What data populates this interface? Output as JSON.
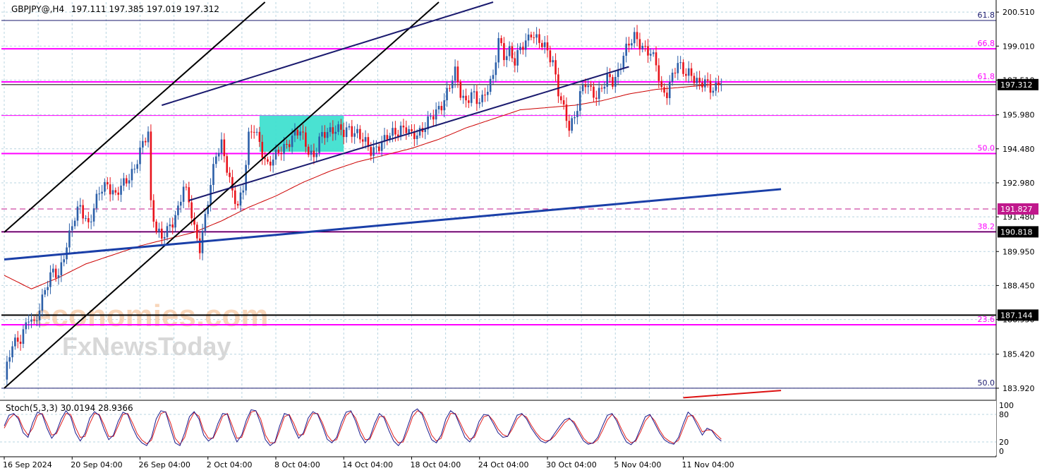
{
  "header": {
    "symbol": "GBPJPY@,H4",
    "ohlc": "197.111 197.385 197.019 197.312"
  },
  "stoch": {
    "label": "Stoch(5,3,3) 30.0194 28.9366",
    "levels": [
      "100",
      "80",
      "20",
      "0"
    ],
    "main": [
      55,
      78,
      82,
      70,
      40,
      30,
      62,
      85,
      80,
      50,
      28,
      42,
      70,
      88,
      75,
      40,
      22,
      38,
      72,
      86,
      78,
      48,
      25,
      35,
      65,
      85,
      80,
      52,
      30,
      18,
      12,
      30,
      70,
      88,
      85,
      50,
      18,
      12,
      40,
      75,
      86,
      70,
      35,
      22,
      30,
      60,
      82,
      80,
      45,
      20,
      35,
      68,
      90,
      88,
      60,
      25,
      12,
      20,
      55,
      82,
      78,
      50,
      28,
      40,
      72,
      86,
      80,
      55,
      26,
      18,
      30,
      62,
      85,
      88,
      65,
      35,
      18,
      30,
      60,
      82,
      72,
      45,
      22,
      12,
      25,
      55,
      85,
      92,
      80,
      50,
      25,
      18,
      35,
      70,
      88,
      80,
      55,
      30,
      20,
      35,
      65,
      80,
      78,
      60,
      40,
      30,
      32,
      55,
      78,
      82,
      70,
      50,
      35,
      22,
      18,
      25,
      40,
      55,
      68,
      72,
      60,
      40,
      22,
      15,
      18,
      30,
      55,
      78,
      82,
      65,
      40,
      20,
      14,
      25,
      50,
      75,
      80,
      60,
      40,
      25,
      18,
      15,
      30,
      60,
      85,
      75,
      55,
      35,
      50,
      45,
      30,
      22
    ],
    "signal": [
      50,
      70,
      80,
      74,
      50,
      35,
      50,
      78,
      82,
      60,
      35,
      38,
      60,
      82,
      80,
      52,
      30,
      32,
      60,
      82,
      80,
      58,
      32,
      32,
      55,
      80,
      82,
      62,
      38,
      24,
      16,
      24,
      55,
      82,
      86,
      62,
      28,
      15,
      30,
      65,
      84,
      76,
      45,
      28,
      28,
      50,
      76,
      82,
      56,
      28,
      30,
      58,
      85,
      88,
      70,
      35,
      18,
      18,
      45,
      75,
      80,
      60,
      35,
      36,
      62,
      82,
      82,
      62,
      35,
      22,
      25,
      52,
      78,
      86,
      72,
      45,
      25,
      26,
      50,
      75,
      76,
      55,
      32,
      18,
      20,
      45,
      75,
      88,
      84,
      62,
      35,
      22,
      28,
      58,
      82,
      82,
      62,
      40,
      26,
      30,
      55,
      75,
      78,
      66,
      48,
      36,
      32,
      48,
      70,
      80,
      74,
      56,
      40,
      28,
      22,
      24,
      34,
      48,
      62,
      70,
      64,
      46,
      28,
      18,
      17,
      25,
      45,
      68,
      80,
      70,
      48,
      28,
      18,
      22,
      42,
      66,
      78,
      66,
      46,
      30,
      22,
      17,
      24,
      50,
      76,
      78,
      62,
      42,
      46,
      46,
      36,
      26
    ]
  },
  "chart_data": {
    "type": "candlestick",
    "symbol": "GBPJPY@",
    "timeframe": "H4",
    "last_price": "197.312",
    "ylim": [
      183.45,
      200.95
    ],
    "y_ticks": [
      "200.510",
      "199.010",
      "197.510",
      "195.980",
      "194.480",
      "192.980",
      "191.480",
      "189.950",
      "188.450",
      "186.950",
      "185.420",
      "183.920"
    ],
    "x_ticks": [
      "16 Sep 2024",
      "20 Sep 04:00",
      "26 Sep 04:00",
      "2 Oct 04:00",
      "8 Oct 04:00",
      "14 Oct 04:00",
      "18 Oct 04:00",
      "24 Oct 04:00",
      "30 Oct 04:00",
      "5 Nov 04:00",
      "11 Nov 04:00"
    ],
    "x_tick_positions": [
      0,
      25,
      50,
      75,
      100,
      125,
      150,
      175,
      200,
      225,
      250
    ],
    "anchors": [
      [
        0,
        184.3
      ],
      [
        3,
        185.8
      ],
      [
        6,
        186.2
      ],
      [
        9,
        187.0
      ],
      [
        11,
        186.6
      ],
      [
        13,
        187.5
      ],
      [
        15,
        188.4
      ],
      [
        18,
        189.0
      ],
      [
        20,
        188.8
      ],
      [
        22,
        189.9
      ],
      [
        25,
        191.1
      ],
      [
        28,
        191.9
      ],
      [
        31,
        191.2
      ],
      [
        35,
        192.5
      ],
      [
        38,
        193.0
      ],
      [
        41,
        192.4
      ],
      [
        44,
        192.9
      ],
      [
        48,
        193.7
      ],
      [
        51,
        194.6
      ],
      [
        53,
        195.2
      ],
      [
        54,
        192.1
      ],
      [
        56,
        191.0
      ],
      [
        58,
        190.5
      ],
      [
        60,
        190.8
      ],
      [
        62,
        191.3
      ],
      [
        64,
        191.9
      ],
      [
        66,
        192.8
      ],
      [
        68,
        192.1
      ],
      [
        70,
        191.0
      ],
      [
        72,
        190.2
      ],
      [
        74,
        191.4
      ],
      [
        76,
        192.8
      ],
      [
        78,
        194.3
      ],
      [
        80,
        194.8
      ],
      [
        82,
        193.6
      ],
      [
        84,
        192.4
      ],
      [
        86,
        192.0
      ],
      [
        88,
        192.9
      ],
      [
        90,
        195.0
      ],
      [
        92,
        195.3
      ],
      [
        95,
        194.4
      ],
      [
        97,
        193.8
      ],
      [
        100,
        194.1
      ],
      [
        103,
        194.6
      ],
      [
        106,
        195.0
      ],
      [
        109,
        195.2
      ],
      [
        112,
        194.5
      ],
      [
        114,
        194.1
      ],
      [
        116,
        194.8
      ],
      [
        119,
        195.3
      ],
      [
        122,
        195.4
      ],
      [
        125,
        195.1
      ],
      [
        127,
        195.4
      ],
      [
        130,
        195.2
      ],
      [
        132,
        194.8
      ],
      [
        135,
        194.4
      ],
      [
        137,
        194.6
      ],
      [
        140,
        194.8
      ],
      [
        143,
        195.2
      ],
      [
        146,
        195.4
      ],
      [
        148,
        195.3
      ],
      [
        150,
        195.0
      ],
      [
        152,
        195.2
      ],
      [
        155,
        195.5
      ],
      [
        158,
        195.9
      ],
      [
        161,
        196.5
      ],
      [
        164,
        197.2
      ],
      [
        166,
        197.8
      ],
      [
        168,
        197.0
      ],
      [
        170,
        196.6
      ],
      [
        172,
        196.9
      ],
      [
        174,
        196.5
      ],
      [
        176,
        196.7
      ],
      [
        178,
        197.3
      ],
      [
        180,
        197.6
      ],
      [
        182,
        199.2
      ],
      [
        184,
        198.6
      ],
      [
        186,
        198.9
      ],
      [
        188,
        198.3
      ],
      [
        190,
        198.8
      ],
      [
        192,
        199.2
      ],
      [
        194,
        199.7
      ],
      [
        196,
        199.3
      ],
      [
        198,
        199.0
      ],
      [
        200,
        198.8
      ],
      [
        202,
        198.4
      ],
      [
        204,
        197.0
      ],
      [
        206,
        196.1
      ],
      [
        208,
        195.4
      ],
      [
        210,
        196.0
      ],
      [
        212,
        196.9
      ],
      [
        214,
        197.3
      ],
      [
        216,
        197.0
      ],
      [
        218,
        196.9
      ],
      [
        220,
        197.2
      ],
      [
        222,
        197.5
      ],
      [
        224,
        197.4
      ],
      [
        226,
        197.9
      ],
      [
        228,
        198.7
      ],
      [
        230,
        199.0
      ],
      [
        232,
        199.4
      ],
      [
        234,
        199.2
      ],
      [
        236,
        198.9
      ],
      [
        238,
        198.6
      ],
      [
        240,
        198.2
      ],
      [
        242,
        197.1
      ],
      [
        244,
        197.0
      ],
      [
        246,
        197.6
      ],
      [
        248,
        198.2
      ],
      [
        250,
        198.0
      ],
      [
        252,
        197.9
      ],
      [
        254,
        197.5
      ],
      [
        256,
        197.2
      ],
      [
        258,
        197.6
      ],
      [
        260,
        197.2
      ],
      [
        262,
        197.1
      ],
      [
        264,
        197.31
      ]
    ],
    "ma": [
      [
        0,
        188.9
      ],
      [
        10,
        188.3
      ],
      [
        20,
        188.8
      ],
      [
        30,
        189.4
      ],
      [
        40,
        189.8
      ],
      [
        50,
        190.2
      ],
      [
        60,
        190.5
      ],
      [
        70,
        190.8
      ],
      [
        80,
        191.3
      ],
      [
        90,
        191.9
      ],
      [
        100,
        192.4
      ],
      [
        110,
        193.0
      ],
      [
        120,
        193.5
      ],
      [
        130,
        193.9
      ],
      [
        140,
        194.2
      ],
      [
        150,
        194.5
      ],
      [
        160,
        194.9
      ],
      [
        170,
        195.4
      ],
      [
        180,
        195.8
      ],
      [
        190,
        196.2
      ],
      [
        200,
        196.3
      ],
      [
        210,
        196.4
      ],
      [
        220,
        196.6
      ],
      [
        230,
        196.9
      ],
      [
        240,
        197.1
      ],
      [
        250,
        197.2
      ],
      [
        264,
        197.35
      ]
    ],
    "horizontal_levels": [
      {
        "price": 200.14,
        "color": "#1a1a6e",
        "width": 1,
        "dash": "",
        "label": "61.8",
        "label_color": "#1a1a6e",
        "badge": ""
      },
      {
        "price": 198.89,
        "color": "#ff00ff",
        "width": 2,
        "dash": "",
        "label": "66.8",
        "label_color": "#ff00ff",
        "badge": ""
      },
      {
        "price": 197.43,
        "color": "#ff00ff",
        "width": 2,
        "dash": "",
        "label": "61.8",
        "label_color": "#ff00ff",
        "badge": ""
      },
      {
        "price": 197.312,
        "color": "#000000",
        "width": 1,
        "dash": "",
        "label": "",
        "label_color": "",
        "badge": "197.312",
        "badge_bg": "#000000"
      },
      {
        "price": 195.95,
        "color": "#ff00ff",
        "width": 1,
        "dash": "",
        "label": "",
        "label_color": "",
        "badge": ""
      },
      {
        "price": 194.27,
        "color": "#ff00ff",
        "width": 2,
        "dash": "",
        "label": "50.0",
        "label_color": "#ff00ff",
        "badge": ""
      },
      {
        "price": 191.827,
        "color": "#c0188c",
        "width": 1,
        "dash": "8,5",
        "label": "",
        "label_color": "",
        "badge": "191.827",
        "badge_bg": "#c0188c"
      },
      {
        "price": 190.818,
        "color": "#ff00ff",
        "width": 2,
        "dash": "",
        "label": "38.2",
        "label_color": "#ff00ff",
        "badge": ""
      },
      {
        "price": 190.818,
        "color": "#000000",
        "width": 1,
        "dash": "",
        "label": "",
        "label_color": "",
        "badge": "190.818",
        "badge_bg": "#000000"
      },
      {
        "price": 187.144,
        "color": "#000000",
        "width": 2,
        "dash": "",
        "label": "",
        "label_color": "",
        "badge": "187.144",
        "badge_bg": "#000000"
      },
      {
        "price": 186.72,
        "color": "#ff00ff",
        "width": 2,
        "dash": "",
        "label": "23.6",
        "label_color": "#ff00ff",
        "badge": ""
      },
      {
        "price": 183.92,
        "color": "#1a1a6e",
        "width": 1,
        "dash": "",
        "label": "50.0",
        "label_color": "#1a1a6e",
        "badge": ""
      }
    ],
    "trendlines": [
      {
        "name": "channel-outer",
        "color": "#000000",
        "width": 2,
        "p1": [
          0,
          190.8
        ],
        "p2": [
          96,
          200.95
        ]
      },
      {
        "name": "channel-inner",
        "color": "#000000",
        "width": 2,
        "p1": [
          0,
          183.92
        ],
        "p2": [
          160,
          200.95
        ]
      },
      {
        "name": "upper-wedge",
        "color": "#1a1a6e",
        "width": 2,
        "p1": [
          58,
          196.4
        ],
        "p2": [
          180,
          200.95
        ]
      },
      {
        "name": "lower-wedge",
        "color": "#1a1a6e",
        "width": 2,
        "p1": [
          68,
          192.2
        ],
        "p2": [
          230,
          198.1
        ]
      },
      {
        "name": "long-support",
        "color": "#1a3fa8",
        "width": 3,
        "p1": [
          0,
          189.6
        ],
        "p2": [
          286,
          192.7
        ]
      },
      {
        "name": "lower-red",
        "color": "#dd1111",
        "width": 2,
        "p1": [
          250,
          183.5
        ],
        "p2": [
          286,
          183.82
        ]
      }
    ],
    "box": {
      "x1": 94,
      "x2": 125,
      "y1": 194.35,
      "y2": 195.95,
      "color": "#40e0d0"
    },
    "colors": {
      "bull": "#2b5fa8",
      "bear": "#e8141c",
      "ma": "#cc0000",
      "grid": "#b8d4e0",
      "axis": "#000000"
    },
    "grid": true,
    "legend": "none"
  },
  "watermark": {
    "line1": "economies.com",
    "line2": "FxNewsToday"
  }
}
